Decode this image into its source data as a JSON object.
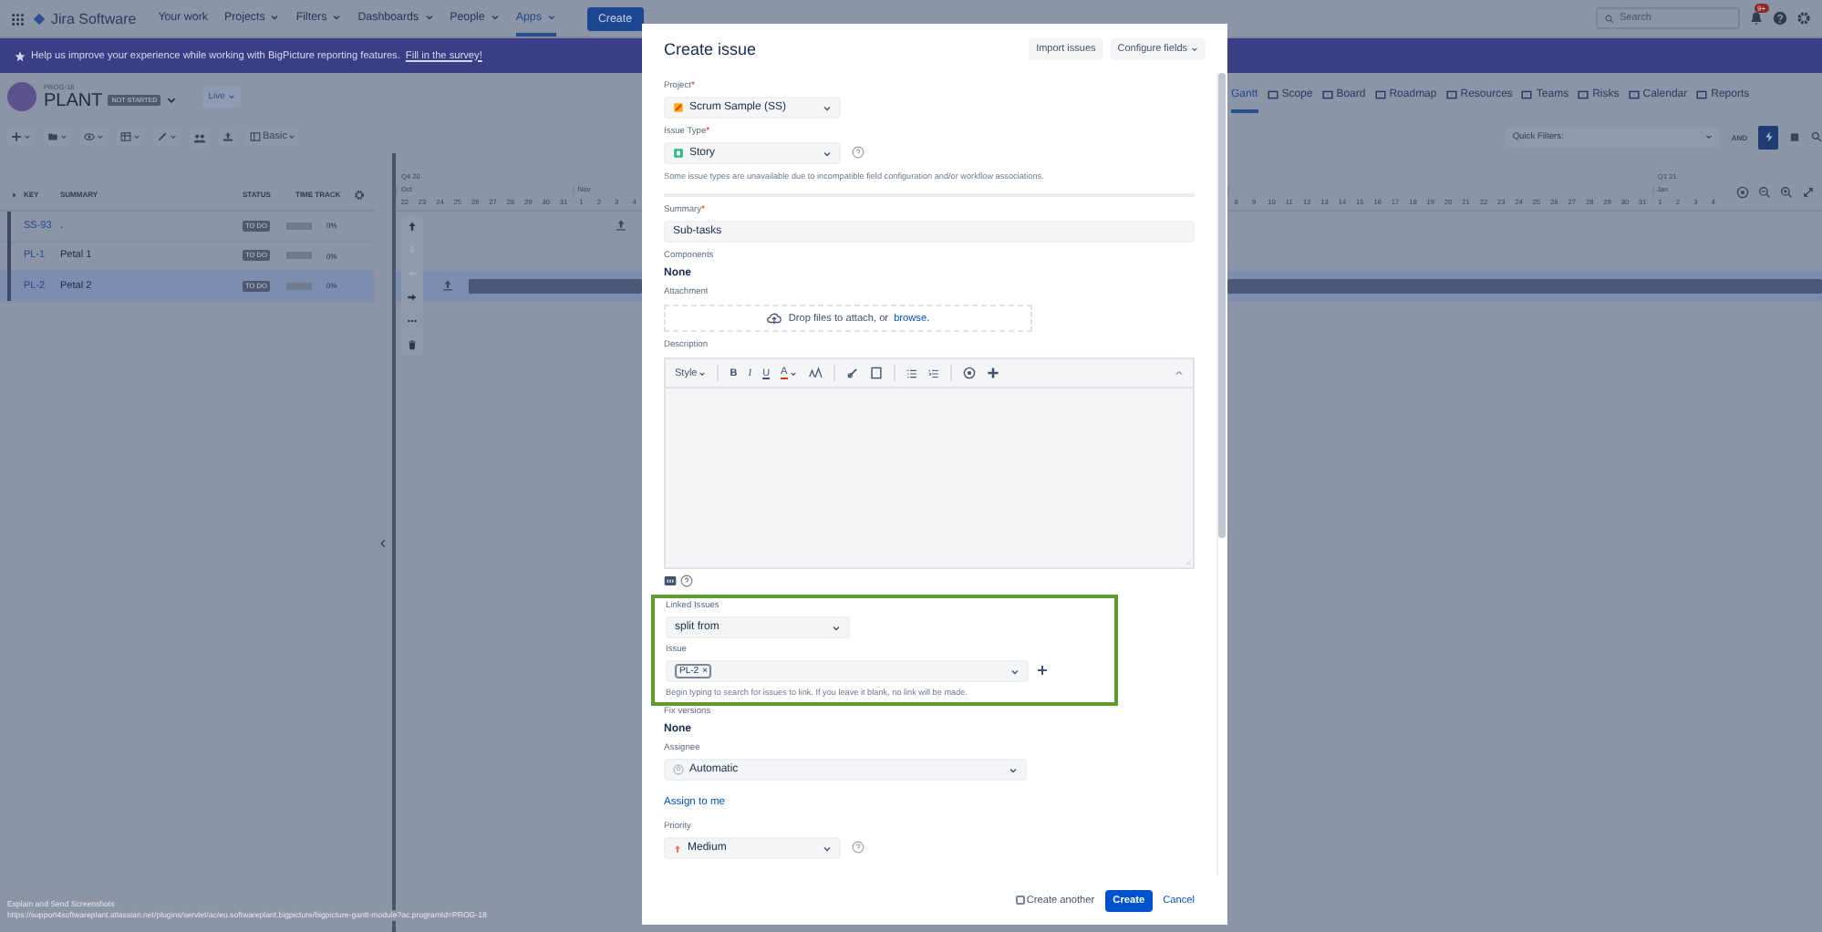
{
  "nav": {
    "product": "Jira Software",
    "items": [
      {
        "label": "Your work",
        "dropdown": false,
        "selected": false
      },
      {
        "label": "Projects",
        "dropdown": true,
        "selected": false
      },
      {
        "label": "Filters",
        "dropdown": true,
        "selected": false
      },
      {
        "label": "Dashboards",
        "dropdown": true,
        "selected": false
      },
      {
        "label": "People",
        "dropdown": true,
        "selected": false
      },
      {
        "label": "Apps",
        "dropdown": true,
        "selected": true
      }
    ],
    "create": "Create",
    "search_placeholder": "Search",
    "badge": "9+"
  },
  "banner": {
    "text": "Help us improve your experience while working with BigPicture reporting features.",
    "link": "Fill in the survey!"
  },
  "program": {
    "key": "PROG-18",
    "name": "PLANT",
    "status": "NOT STARTED",
    "mode": "Live",
    "view": "Basic"
  },
  "tabs": [
    {
      "label": "Gantt",
      "selected": true
    },
    {
      "label": "Scope",
      "selected": false
    },
    {
      "label": "Board",
      "selected": false
    },
    {
      "label": "Roadmap",
      "selected": false
    },
    {
      "label": "Resources",
      "selected": false
    },
    {
      "label": "Teams",
      "selected": false
    },
    {
      "label": "Risks",
      "selected": false
    },
    {
      "label": "Calendar",
      "selected": false
    },
    {
      "label": "Reports",
      "selected": false
    }
  ],
  "quick_filters": {
    "placeholder": "Quick Filters:",
    "operator": "AND"
  },
  "table": {
    "columns": [
      "KEY",
      "SUMMARY",
      "STATUS",
      "TIME TRACK"
    ],
    "rows": [
      {
        "key": "SS-93",
        "summary": ".",
        "status": "TO DO",
        "level": 0,
        "progress": "0%",
        "selected": false
      },
      {
        "key": "PL-1",
        "summary": "Petal 1",
        "status": "TO DO",
        "level": 0,
        "progress": "0%",
        "selected": false
      },
      {
        "key": "PL-2",
        "summary": "Petal 2",
        "status": "TO DO",
        "level": 0,
        "progress": "0%",
        "selected": true
      }
    ]
  },
  "timeline_left": {
    "quarter": "Q4 20",
    "months": [
      {
        "label": "Oct",
        "days": [
          "22",
          "23",
          "24",
          "25",
          "26",
          "27",
          "28",
          "29",
          "30",
          "31"
        ]
      },
      {
        "label": "Nov",
        "days": [
          "1",
          "2",
          "3",
          "4"
        ]
      }
    ]
  },
  "timeline_right": {
    "quarter": "Q1 21",
    "months": [
      {
        "days": [
          "8",
          "9",
          "10",
          "11",
          "12",
          "13",
          "14",
          "15",
          "16",
          "17",
          "18",
          "19",
          "20",
          "21",
          "22",
          "23",
          "24",
          "25",
          "26",
          "27",
          "28",
          "29",
          "30",
          "31"
        ]
      },
      {
        "label": "Jan",
        "days": [
          "1",
          "2",
          "3",
          "4"
        ]
      }
    ]
  },
  "dialog": {
    "title": "Create issue",
    "buttons": [
      "Import issues",
      "Configure fields"
    ],
    "required_mark": "*",
    "project": {
      "label": "Project",
      "required": true,
      "value": "Scrum Sample (SS)"
    },
    "issue_type": {
      "label": "Issue Type",
      "required": true,
      "value": "Story",
      "help": "Some issue types are unavailable due to incompatible field configuration and/or workflow associations."
    },
    "summary": {
      "label": "Summary",
      "required": true,
      "value": "Sub-tasks"
    },
    "components": {
      "label": "Components",
      "value": "None"
    },
    "attachment": {
      "label": "Attachment",
      "text": "Drop files to attach, or",
      "link": "browse."
    },
    "description": {
      "label": "Description",
      "tools": [
        {
          "kind": "style",
          "label": "Style"
        },
        {
          "kind": "bold",
          "label": "B"
        },
        {
          "kind": "italic",
          "label": "I"
        },
        {
          "kind": "underline",
          "label": "U"
        },
        {
          "kind": "color",
          "label": "A"
        }
      ]
    },
    "linked_issues": {
      "label": "Linked Issues",
      "value": "split from",
      "highlighted": true
    },
    "issue": {
      "label": "Issue",
      "tag": "PL-2",
      "remove": "×",
      "help": "Begin typing to search for issues to link. If you leave it blank, no link will be made."
    },
    "fix_versions": {
      "label": "Fix versions",
      "value": "None"
    },
    "assignee": {
      "label": "Assignee",
      "value": "Automatic",
      "link": "Assign to me"
    },
    "priority": {
      "label": "Priority",
      "value": "Medium"
    },
    "footer": {
      "create_another": {
        "label": "Create another",
        "checked": false
      },
      "create": "Create",
      "cancel": "Cancel"
    }
  },
  "screenshot_note": {
    "title": "Explain and Send Screenshots",
    "url": "https://support4softwareplant.atlassian.net/plugins/servlet/ac/eu.softwareplant.bigpicture/bigpicture-gantt-module?ac.programId=PROG-18"
  }
}
